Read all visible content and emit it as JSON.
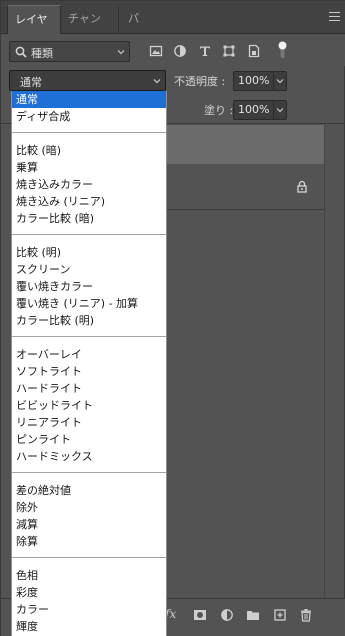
{
  "tabs": [
    {
      "label": "レイヤー",
      "active": true
    },
    {
      "label": "チャンネル",
      "active": false
    },
    {
      "label": "パス",
      "active": false
    }
  ],
  "filter": {
    "kind_label": "種類",
    "icons": [
      "image-filter-icon",
      "adjustment-filter-icon",
      "type-filter-icon",
      "shape-filter-icon",
      "smart-object-filter-icon"
    ]
  },
  "blend": {
    "current": "通常",
    "opacity_label": "不透明度 :",
    "opacity_value": "100%",
    "fill_label": "塗り :",
    "fill_value": "100%"
  },
  "blend_modes": [
    [
      "通常",
      "ディザ合成"
    ],
    [
      "比較 (暗)",
      "乗算",
      "焼き込みカラー",
      "焼き込み (リニア)",
      "カラー比較 (暗)"
    ],
    [
      "比較 (明)",
      "スクリーン",
      "覆い焼きカラー",
      "覆い焼き (リニア) - 加算",
      "カラー比較 (明)"
    ],
    [
      "オーバーレイ",
      "ソフトライト",
      "ハードライト",
      "ビビッドライト",
      "リニアライト",
      "ピンライト",
      "ハードミックス"
    ],
    [
      "差の絶対値",
      "除外",
      "減算",
      "除算"
    ],
    [
      "色相",
      "彩度",
      "カラー",
      "輝度"
    ]
  ],
  "colors": {
    "panel_bg": "#535353",
    "selected_item": "#1e6fd6",
    "selected_layer": "#6b6b6b"
  }
}
